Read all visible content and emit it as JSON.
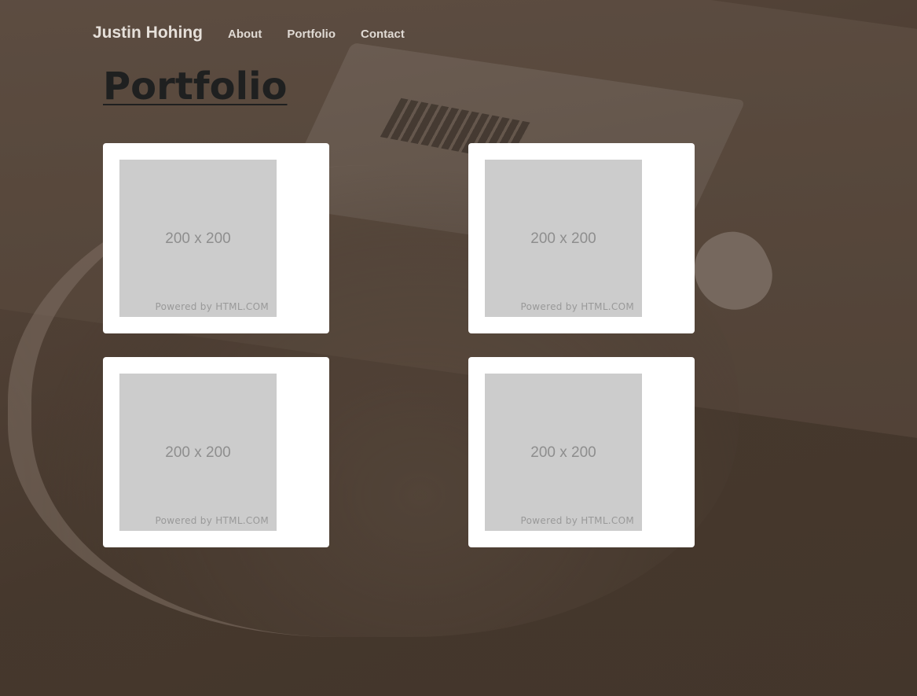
{
  "nav": {
    "brand": "Justin Hohing",
    "links": [
      "About",
      "Portfolio",
      "Contact"
    ]
  },
  "page": {
    "title": "Portfolio"
  },
  "portfolio": {
    "items": [
      {
        "size": "200 x 200",
        "credit": "Powered by HTML.COM"
      },
      {
        "size": "200 x 200",
        "credit": "Powered by HTML.COM"
      },
      {
        "size": "200 x 200",
        "credit": "Powered by HTML.COM"
      },
      {
        "size": "200 x 200",
        "credit": "Powered by HTML.COM"
      }
    ]
  },
  "colors": {
    "card_background": "#ffffff",
    "placeholder_gray": "#cccccc",
    "page_tint": "#4f4137"
  }
}
